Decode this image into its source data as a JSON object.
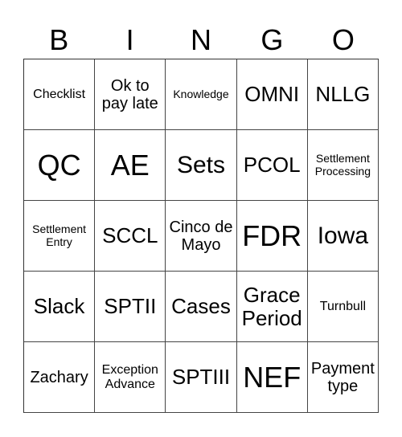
{
  "header": {
    "letters": [
      "B",
      "I",
      "N",
      "G",
      "O"
    ]
  },
  "cells": [
    {
      "text": "Checklist",
      "size": "s"
    },
    {
      "text": "Ok to pay late",
      "size": "m"
    },
    {
      "text": "Knowledge",
      "size": "xs"
    },
    {
      "text": "OMNI",
      "size": "l"
    },
    {
      "text": "NLLG",
      "size": "l"
    },
    {
      "text": "QC",
      "size": "xxl"
    },
    {
      "text": "AE",
      "size": "xxl"
    },
    {
      "text": "Sets",
      "size": "xl"
    },
    {
      "text": "PCOL",
      "size": "l"
    },
    {
      "text": "Settlement Processing",
      "size": "xs"
    },
    {
      "text": "Settlement Entry",
      "size": "xs"
    },
    {
      "text": "SCCL",
      "size": "l"
    },
    {
      "text": "Cinco de Mayo",
      "size": "m"
    },
    {
      "text": "FDR",
      "size": "xxl"
    },
    {
      "text": "Iowa",
      "size": "xl"
    },
    {
      "text": "Slack",
      "size": "l"
    },
    {
      "text": "SPTII",
      "size": "l"
    },
    {
      "text": "Cases",
      "size": "l"
    },
    {
      "text": "Grace Period",
      "size": "l"
    },
    {
      "text": "Turnbull",
      "size": "s"
    },
    {
      "text": "Zachary",
      "size": "m"
    },
    {
      "text": "Exception Advance",
      "size": "s"
    },
    {
      "text": "SPTIII",
      "size": "l"
    },
    {
      "text": "NEF",
      "size": "xxl"
    },
    {
      "text": "Payment type",
      "size": "m"
    }
  ]
}
